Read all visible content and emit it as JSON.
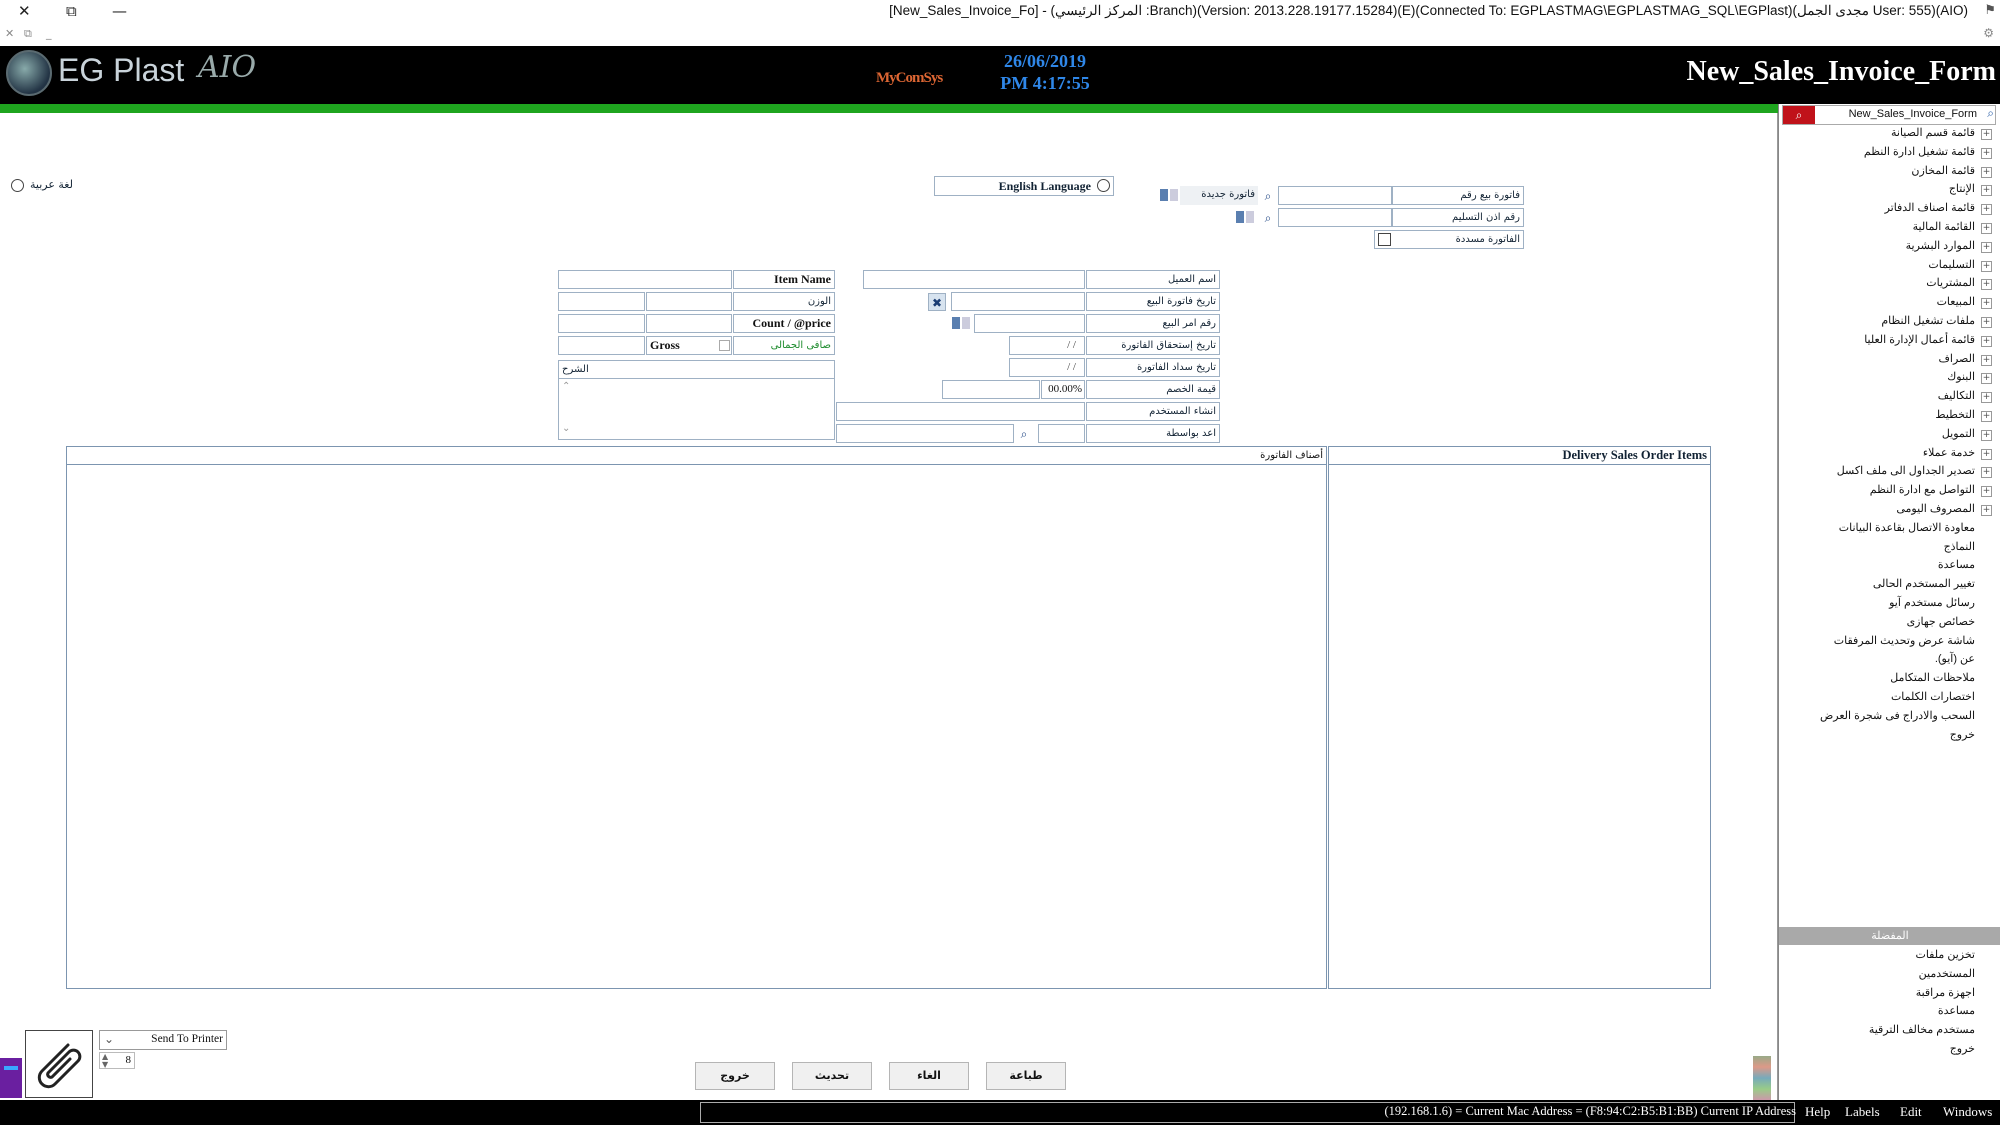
{
  "window": {
    "title": "[New_Sales_Invoice_Fo] - (المركز الرئيسي :Branch)(Version: 2013.228.19177.15284)(E)(Connected To: EGPLASTMAG\\EGPLASTMAG_SQL\\EGPlast)(مجدى الجمل User: 555)(AIO)",
    "close": "✕",
    "restore": "⧉",
    "minimize": "—"
  },
  "header": {
    "logo_text": "EG Plast",
    "logo_sub": "AIO",
    "brand": "MyComSys",
    "date": "26/06/2019",
    "time": "PM 4:17:55",
    "form_title": "New_Sales_Invoice_Form"
  },
  "language": {
    "arabic": "لغة عربية",
    "english": "English Language"
  },
  "invoice": {
    "invoice_no_label": "فاتورة بيع رقم",
    "delivery_no_label": "رقم اذن التسليم",
    "new_invoice_label": "فاتورة جديدة",
    "paid_invoice_label": "الفاتورة مسددة",
    "customer_name_label": "اسم العميل",
    "sale_date_label": "تاريخ فاتورة البيع",
    "sales_order_label": "رقم امر البيع",
    "due_date_label": "تاريخ إستحقاق الفاتورة",
    "payment_date_label": "تاريخ سداد الفاتورة",
    "discount_label": "قيمة الخصم",
    "discount_value": "00.00%",
    "created_by_label": "انشاء المستخدم",
    "prepared_by_label": "اعد بواسطة",
    "date_placeholder": "/ /",
    "item_name_label": "Item Name",
    "weight_label": "الوزن",
    "count_price_label": "Count / @price",
    "net_total_label": "صافى الجمالى",
    "gross_label": "Gross",
    "description_label": "الشرح"
  },
  "grids": {
    "invoice_items": "أصناف الفاتورة",
    "delivery_items": "Delivery Sales Order Items"
  },
  "printer": {
    "label": "Send To Printer",
    "copies": "8"
  },
  "buttons": {
    "exit": "خروج",
    "refresh": "تحديث",
    "cancel": "الغاء",
    "print": "طباعة"
  },
  "sidebar": {
    "search_text": "New_Sales_Invoice_Form",
    "items": [
      {
        "label": "قائمة قسم الصيانة",
        "expand": true
      },
      {
        "label": "قائمة تشغيل ادارة النظم",
        "expand": true
      },
      {
        "label": "قائمة المخازن",
        "expand": true
      },
      {
        "label": "الإنتاج",
        "expand": true
      },
      {
        "label": "قائمة اصناف الدفاتر",
        "expand": true
      },
      {
        "label": "القائمة المالية",
        "expand": true
      },
      {
        "label": "الموارد البشرية",
        "expand": true
      },
      {
        "label": "التسليمات",
        "expand": true
      },
      {
        "label": "المشتريات",
        "expand": true
      },
      {
        "label": "المبيعات",
        "expand": true
      },
      {
        "label": "ملفات تشغيل النظام",
        "expand": true
      },
      {
        "label": "قائمة أعمال الإدارة العليا",
        "expand": true
      },
      {
        "label": "الصراف",
        "expand": true
      },
      {
        "label": "البنوك",
        "expand": true
      },
      {
        "label": "التكاليف",
        "expand": true
      },
      {
        "label": "التخطيط",
        "expand": true
      },
      {
        "label": "التمويل",
        "expand": true
      },
      {
        "label": "خدمة عملاء",
        "expand": true
      },
      {
        "label": "تصدير الجداول الى ملف اكسل",
        "expand": true
      },
      {
        "label": "التواصل مع ادارة النظم",
        "expand": true
      },
      {
        "label": "المصروف اليومى",
        "expand": true
      },
      {
        "label": "معاودة الاتصال بقاعدة البيانات",
        "expand": false
      },
      {
        "label": "النماذج",
        "expand": false
      },
      {
        "label": "مساعدة",
        "expand": false
      },
      {
        "label": "تغيير المستخدم الحالى",
        "expand": false
      },
      {
        "label": "رسائل مستخدم آيو",
        "expand": false
      },
      {
        "label": "خصائص جهازى",
        "expand": false
      },
      {
        "label": "شاشة عرض وتحديث المرفقات",
        "expand": false
      },
      {
        "label": "عن (آيو).",
        "expand": false
      },
      {
        "label": "ملاحظات المتكامل",
        "expand": false
      },
      {
        "label": "اختصارات الكلمات",
        "expand": false
      },
      {
        "label": "السحب والادراج فى شجرة العرض",
        "expand": false
      },
      {
        "label": "خروج",
        "expand": false
      }
    ],
    "bottom_title": "المفضلة",
    "bottom_items": [
      {
        "label": "تخزين ملفات"
      },
      {
        "label": "المستخدمين"
      },
      {
        "label": "اجهزة مراقبة"
      },
      {
        "label": "مساعدة"
      },
      {
        "label": "مستخدم مخالف الترقية"
      },
      {
        "label": "خروج"
      }
    ]
  },
  "status": {
    "text": "(192.168.1.6) = Current Mac Address = (F8:94:C2:B5:B1:BB) Current IP Address",
    "menus": [
      "Help",
      "Labels",
      "Edit",
      "Windows"
    ]
  },
  "colors": {
    "accent_green": "#1fa51f",
    "date_blue": "#2f87e8",
    "search_red": "#c0121a"
  }
}
